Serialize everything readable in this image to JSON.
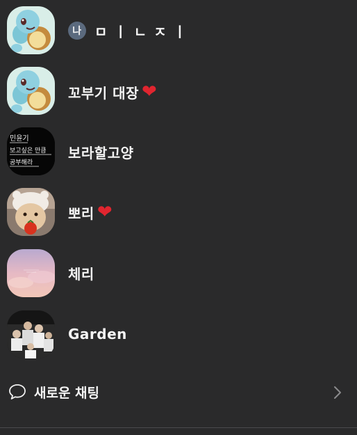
{
  "chats": [
    {
      "name": "나 ㅁ ㅣ ㄴ ㅈ ㅣ",
      "badge": "나",
      "rest": "ㅁㅣㄴㅈㅣ",
      "avatar": "squirtle-avatar",
      "heart": false
    },
    {
      "name": "꼬부기 대장",
      "avatar": "squirtle-avatar",
      "heart": true
    },
    {
      "name": "보라할고양",
      "avatar": "text-note-avatar",
      "avatar_text": [
        "민윤기",
        "보고싶은 만큼",
        "공부해라"
      ],
      "heart": false
    },
    {
      "name": "뽀리",
      "avatar": "cat-avatar",
      "heart": true
    },
    {
      "name": "체리",
      "avatar": "pink-sky-avatar",
      "heart": false
    },
    {
      "name": "Garden",
      "avatar": "group-photo-avatar",
      "heart": false
    }
  ],
  "heart_symbol": "❤",
  "new_chat": {
    "label": "새로운 채팅",
    "icon": "chat-bubble-icon",
    "chevron": "chevron-right-icon"
  },
  "colors": {
    "background": "#2a2a2b",
    "text": "#f4f4f4",
    "heart": "#e0252f",
    "badge": "#5b6a7e",
    "muted": "#8a8a8c"
  }
}
